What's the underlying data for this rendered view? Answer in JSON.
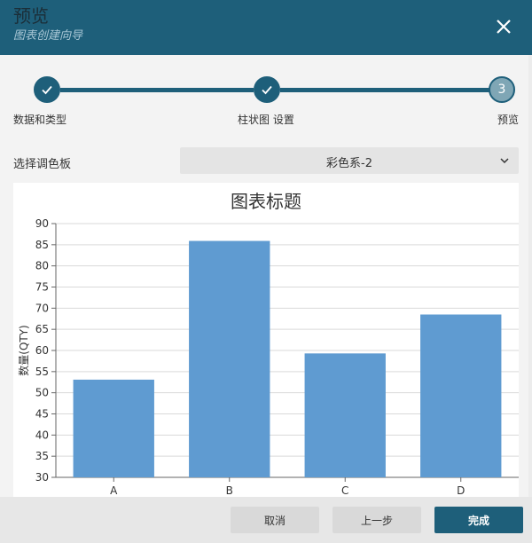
{
  "header": {
    "title": "预览",
    "subtitle": "图表创建向导",
    "close_icon": "close-icon"
  },
  "steps": [
    {
      "label": "数据和类型",
      "number": "1",
      "state": "done"
    },
    {
      "label": "柱状图 设置",
      "number": "2",
      "state": "done"
    },
    {
      "label": "预览",
      "number": "3",
      "state": "current"
    }
  ],
  "palette": {
    "label": "选择调色板",
    "selected": "彩色系-2"
  },
  "footer": {
    "cancel_label": "取消",
    "prev_label": "上一步",
    "finish_label": "完成"
  },
  "colors": {
    "header_bg": "#1e5f7a",
    "bar_fill": "#5f9bd1",
    "primary_button": "#1e5f7a"
  },
  "chart_data": {
    "type": "bar",
    "title": "图表标题",
    "xlabel": "",
    "ylabel": "数量(QTY)",
    "categories": [
      "A",
      "B",
      "C",
      "D"
    ],
    "values": [
      53.1,
      85.9,
      59.3,
      68.5
    ],
    "ylim": [
      30,
      90
    ],
    "yticks": [
      30,
      35,
      40,
      45,
      50,
      55,
      60,
      65,
      70,
      75,
      80,
      85,
      90
    ],
    "grid": true,
    "legend": "none"
  }
}
